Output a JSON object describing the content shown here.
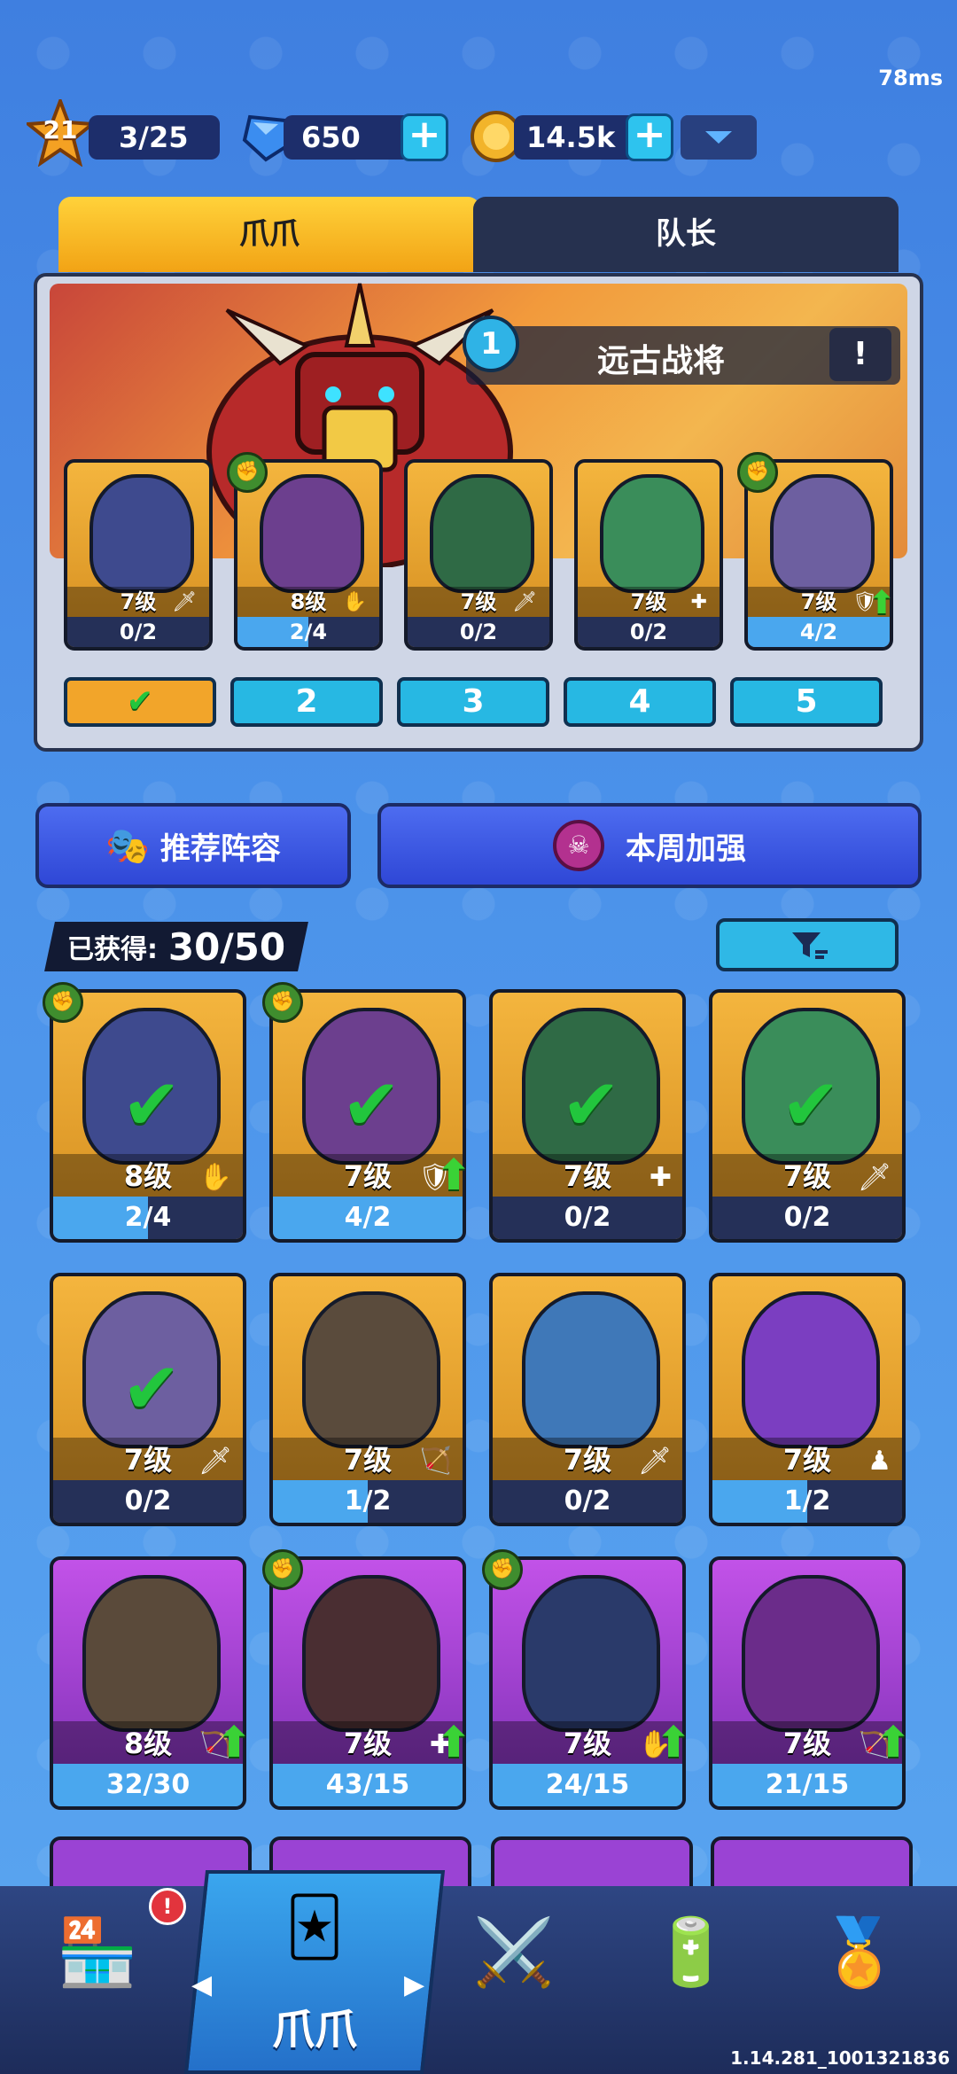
{
  "status": {
    "ping": "78ms"
  },
  "topbar": {
    "level": "21",
    "energy": "3/25",
    "gems": "650",
    "coins": "14.5k"
  },
  "tabs": {
    "active": "爪爪",
    "inactive": "队长"
  },
  "boss": {
    "stage": "1",
    "name": "远古战将",
    "info": "!"
  },
  "squad": [
    {
      "level": "7级",
      "progress": "0/2",
      "fill": 0.0,
      "icon": "sword-icon",
      "bonus": false,
      "upgrade": false
    },
    {
      "level": "8级",
      "progress": "2/4",
      "fill": 0.5,
      "icon": "claw-icon",
      "bonus": true,
      "upgrade": false
    },
    {
      "level": "7级",
      "progress": "0/2",
      "fill": 0.0,
      "icon": "sword-icon",
      "bonus": false,
      "upgrade": false
    },
    {
      "level": "7级",
      "progress": "0/2",
      "fill": 0.0,
      "icon": "heal-icon",
      "bonus": false,
      "upgrade": false
    },
    {
      "level": "7级",
      "progress": "4/2",
      "fill": 1.0,
      "icon": "shield-icon",
      "bonus": true,
      "upgrade": true
    }
  ],
  "slots": [
    "✔",
    "2",
    "3",
    "4",
    "5"
  ],
  "buttons": {
    "recommend": "推荐阵容",
    "weekly": "本周加强"
  },
  "collection": {
    "label": "已获得:",
    "count": "30/50"
  },
  "pets": [
    {
      "level": "8级",
      "progress": "2/4",
      "fill": 0.5,
      "check": true,
      "bonus": true,
      "upgrade": false,
      "color": "gold",
      "icon": "claw-icon"
    },
    {
      "level": "7级",
      "progress": "4/2",
      "fill": 1.0,
      "check": true,
      "bonus": true,
      "upgrade": true,
      "color": "gold",
      "icon": "shield-icon"
    },
    {
      "level": "7级",
      "progress": "0/2",
      "fill": 0.0,
      "check": true,
      "bonus": false,
      "upgrade": false,
      "color": "gold",
      "icon": "heal-icon"
    },
    {
      "level": "7级",
      "progress": "0/2",
      "fill": 0.0,
      "check": true,
      "bonus": false,
      "upgrade": false,
      "color": "gold",
      "icon": "sword-icon"
    },
    {
      "level": "7级",
      "progress": "0/2",
      "fill": 0.0,
      "check": true,
      "bonus": false,
      "upgrade": false,
      "color": "gold",
      "icon": "sword-icon"
    },
    {
      "level": "7级",
      "progress": "1/2",
      "fill": 0.5,
      "check": false,
      "bonus": false,
      "upgrade": false,
      "color": "gold",
      "icon": "bow-icon"
    },
    {
      "level": "7级",
      "progress": "0/2",
      "fill": 0.0,
      "check": false,
      "bonus": false,
      "upgrade": false,
      "color": "gold",
      "icon": "sword-icon"
    },
    {
      "level": "7级",
      "progress": "1/2",
      "fill": 0.5,
      "check": false,
      "bonus": false,
      "upgrade": false,
      "color": "gold",
      "icon": "summon-icon"
    },
    {
      "level": "8级",
      "progress": "32/30",
      "fill": 1.0,
      "check": false,
      "bonus": false,
      "upgrade": true,
      "color": "purple",
      "icon": "bow-icon"
    },
    {
      "level": "7级",
      "progress": "43/15",
      "fill": 1.0,
      "check": false,
      "bonus": true,
      "upgrade": true,
      "color": "purple",
      "icon": "heal-icon"
    },
    {
      "level": "7级",
      "progress": "24/15",
      "fill": 1.0,
      "check": false,
      "bonus": true,
      "upgrade": true,
      "color": "purple",
      "icon": "claw-icon"
    },
    {
      "level": "7级",
      "progress": "21/15",
      "fill": 1.0,
      "check": false,
      "bonus": false,
      "upgrade": true,
      "color": "purple",
      "icon": "bow-icon"
    }
  ],
  "nav": {
    "active_label": "爪爪",
    "shop_alert": "!",
    "items": [
      "shop-icon",
      "pets-icon",
      "battle-icon",
      "battery-icon",
      "badge-icon"
    ]
  },
  "version": "1.14.281_1001321836"
}
